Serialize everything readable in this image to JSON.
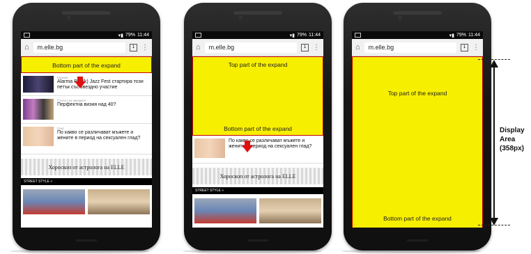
{
  "status_time": "11:44",
  "status_battery": "79%",
  "url": "m.elle.bg",
  "tab_count": "1",
  "expand": {
    "bottom_label": "Bottom part of the expand",
    "top_label": "Top part of the expand"
  },
  "articles": [
    {
      "category": "Музика",
      "title": "Alarma Pun(k) Jazz Fest стартира този петък със звездно участие"
    },
    {
      "category": "Стилът на звездите",
      "title": "Перфектна визия над 40?"
    },
    {
      "category": "Секс",
      "title": "По какво се различават мъжете и жените в период на сексуален глад?"
    }
  ],
  "horoscope_banner": "Хороскоп от астролога на ELLE",
  "street_style": "STREET STYLE »",
  "display_area": {
    "line1": "Display",
    "line2": "Area",
    "line3": "(358px)"
  },
  "colors": {
    "expand_bg": "#f7ef00",
    "expand_border": "#c60000",
    "arrow": "#e01010"
  }
}
